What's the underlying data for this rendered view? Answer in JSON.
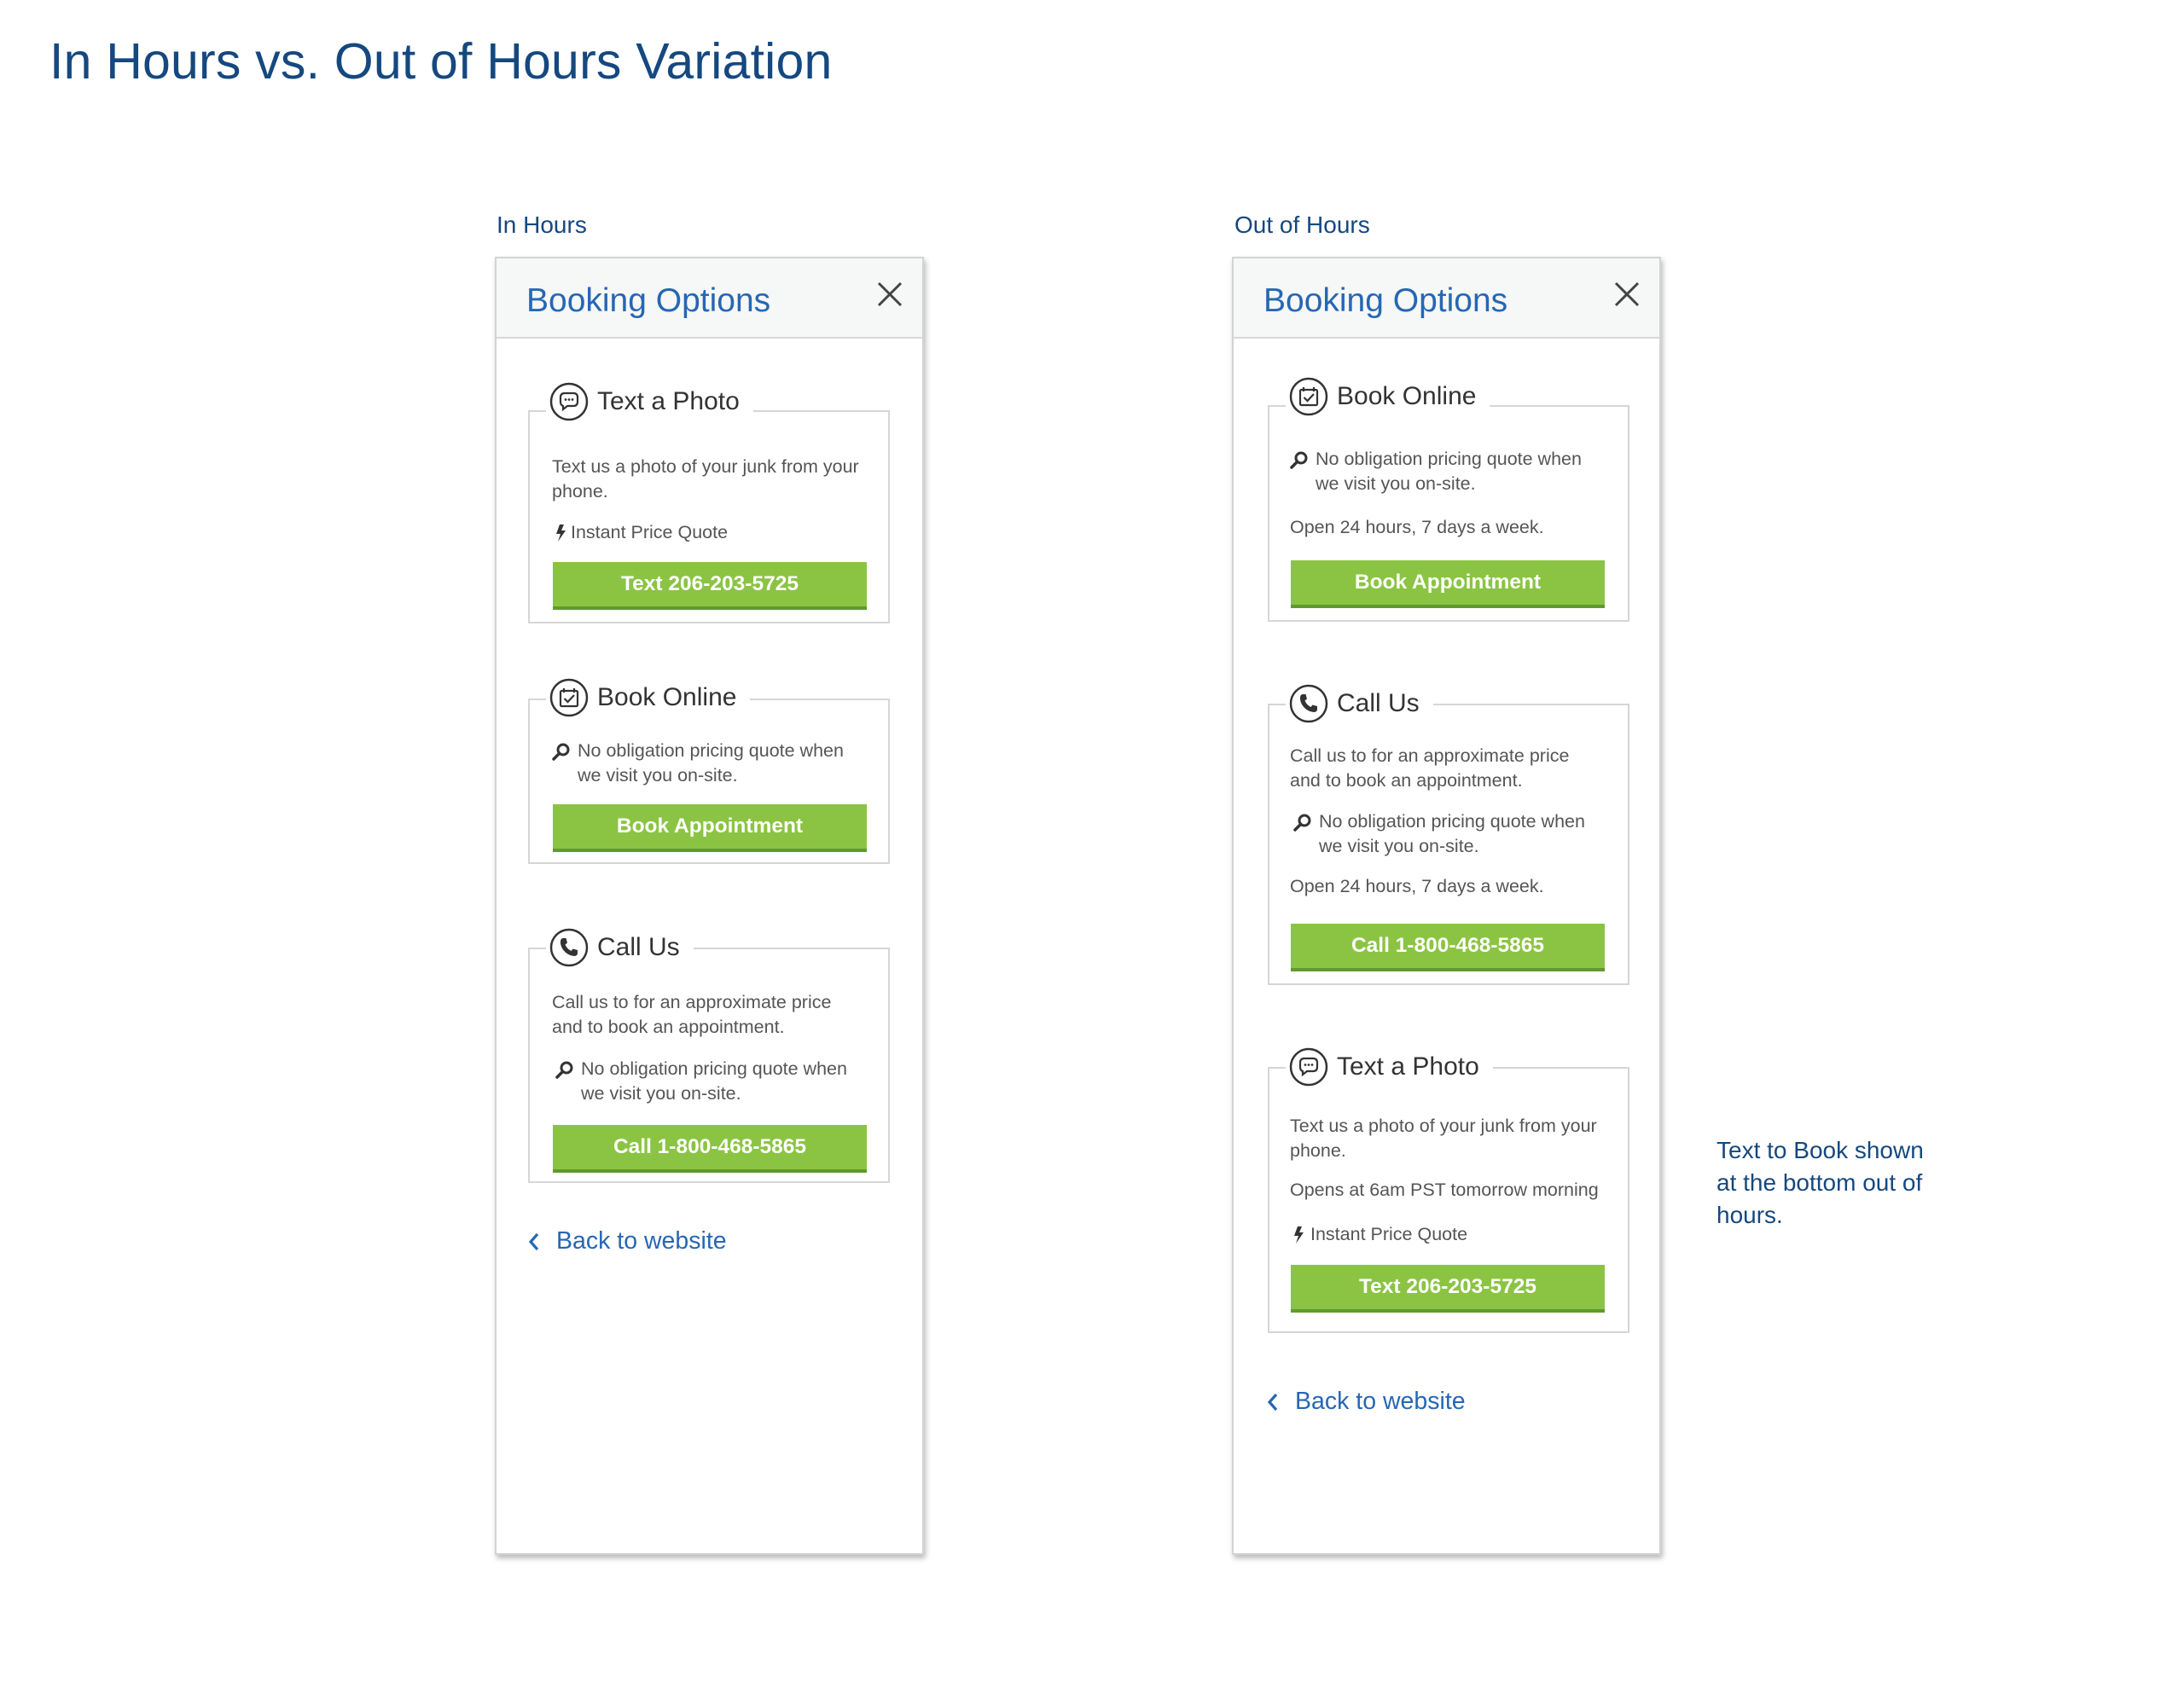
{
  "page_title": "In Hours vs. Out of Hours Variation",
  "side_note_lines": [
    "Text to Book shown",
    "at the bottom out of",
    "hours."
  ],
  "in_hours": {
    "label": "In Hours",
    "panel_title": "Booking Options",
    "text_photo": {
      "title": "Text a Photo",
      "line1": "Text us a photo of your junk from your",
      "line2": "phone.",
      "feature": "Instant Price Quote",
      "button": "Text 206-203-5725"
    },
    "book_online": {
      "title": "Book Online",
      "feature_line1": "No obligation pricing quote when",
      "feature_line2": "we visit you on-site.",
      "button": "Book Appointment"
    },
    "call_us": {
      "title": "Call Us",
      "line1": "Call us to for an approximate price",
      "line2": "and to book an appointment.",
      "feature_line1": "No obligation pricing quote when",
      "feature_line2": "we visit you on-site.",
      "button": "Call 1-800-468-5865"
    },
    "back_link": "Back to website"
  },
  "out_of_hours": {
    "label": "Out of Hours",
    "panel_title": "Booking Options",
    "book_online": {
      "title": "Book Online",
      "feature_line1": "No obligation pricing quote when",
      "feature_line2": "we visit you on-site.",
      "hours": "Open 24 hours, 7 days a week.",
      "button": "Book Appointment"
    },
    "call_us": {
      "title": "Call Us",
      "line1": "Call us to for an approximate price",
      "line2": "and to book an appointment.",
      "feature_line1": "No obligation pricing quote when",
      "feature_line2": "we visit you on-site.",
      "hours": "Open 24 hours, 7 days a week.",
      "button": "Call 1-800-468-5865"
    },
    "text_photo": {
      "title": "Text a Photo",
      "line1": "Text us a photo of your junk from your",
      "line2": "phone.",
      "opens": "Opens at 6am PST tomorrow morning",
      "feature": "Instant Price Quote",
      "button": "Text 206-203-5725"
    },
    "back_link": "Back to website"
  },
  "colors": {
    "heading_blue": "#15487f",
    "link_blue": "#2667b4",
    "button_green": "#8bc443"
  },
  "icons": [
    "chat-bubble-icon",
    "calendar-check-icon",
    "phone-icon",
    "search-icon",
    "lightning-icon",
    "close-icon",
    "chevron-left-icon"
  ]
}
